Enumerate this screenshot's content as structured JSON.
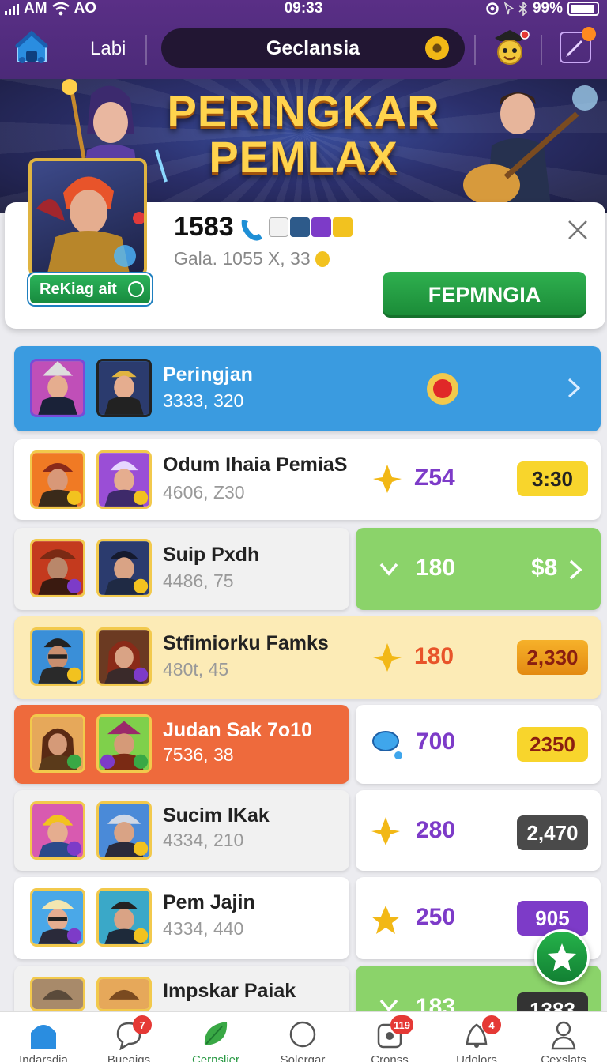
{
  "status_bar": {
    "carrier": "AM",
    "network": "AO",
    "time": "09:33",
    "battery": "99%"
  },
  "app_bar": {
    "home_label": "Labi",
    "search_text": "Geclansia"
  },
  "hero": {
    "title_line1": "PERINGKAR",
    "title_line2": "PEMLAX"
  },
  "profile": {
    "score": "1583",
    "sub_info": "Gala. 1055 X, 33",
    "rank_button": "ReKiag ait",
    "primary_button": "FEPMNGIA"
  },
  "rows": [
    {
      "name": "Peringjan",
      "stat": "3333, 320"
    },
    {
      "name": "Odum Ihaia PemiaS",
      "stat": "4606, Z30",
      "value": "Z54",
      "pill": "3:30"
    },
    {
      "name": "Suip Pxdh",
      "stat": "4486, 75",
      "value": "180",
      "pill": "$8"
    },
    {
      "name": "Stfimiorku Famks",
      "stat": "480t, 45",
      "value": "180",
      "pill": "2,330"
    },
    {
      "name": "Judan Sak 7o10",
      "stat": "7536, 38",
      "value": "700",
      "pill": "2350"
    },
    {
      "name": "Sucim IKak",
      "stat": "4334, 210",
      "value": "280",
      "pill": "2,470"
    },
    {
      "name": "Pem Jajin",
      "stat": "4334, 440",
      "value": "250",
      "pill": "905"
    },
    {
      "name": "Impskar Paiak",
      "stat": "",
      "value": "183",
      "pill": "1383"
    }
  ],
  "bottom_nav": [
    {
      "label": "Indarsdia",
      "badge": ""
    },
    {
      "label": "Bueaiqs",
      "badge": "7"
    },
    {
      "label": "Cernslier",
      "badge": ""
    },
    {
      "label": "Solergar",
      "badge": ""
    },
    {
      "label": "Cronss",
      "badge": "119"
    },
    {
      "label": "Udolors",
      "badge": "4"
    },
    {
      "label": "Cexslats",
      "badge": ""
    }
  ],
  "colors": {
    "accent_purple": "#7d3bc8",
    "primary_green": "#1f9a45",
    "blue_row": "#3a9be0",
    "orange_row": "#ee6a3c",
    "yellow_row": "#fcebb6"
  }
}
